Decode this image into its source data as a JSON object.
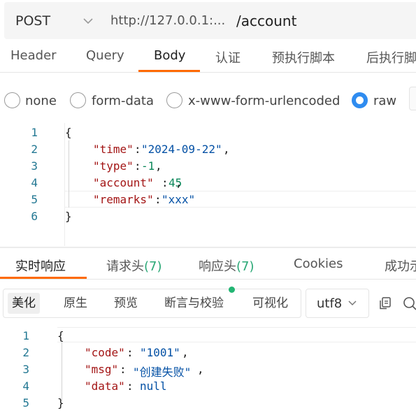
{
  "request": {
    "method": "POST",
    "url_base": "http://127.0.0.1:...",
    "url_path": "/account"
  },
  "request_tabs": [
    {
      "label": "Header"
    },
    {
      "label": "Query"
    },
    {
      "label": "Body"
    },
    {
      "label": "认证"
    },
    {
      "label": "预执行脚本"
    },
    {
      "label": "后执行脚"
    }
  ],
  "active_request_tab": "Body",
  "body_types": [
    {
      "label": "none",
      "checked": false
    },
    {
      "label": "form-data",
      "checked": false
    },
    {
      "label": "x-www-form-urlencoded",
      "checked": false
    },
    {
      "label": "raw",
      "checked": true
    }
  ],
  "request_body": {
    "line_numbers": [
      "1",
      "2",
      "3",
      "4",
      "5",
      "6"
    ],
    "open_brace": "{",
    "close_brace": "}",
    "key_time": "\"time\"",
    "val_time": "\"2024-09-22\"",
    "key_type": "\"type\"",
    "val_type": "-1",
    "key_account": "\"account\"",
    "val_account": "45",
    "key_remarks": "\"remarks\"",
    "val_remarks": "\"xxx\"",
    "colon": ":",
    "comma": ","
  },
  "response_tabs": [
    {
      "label": "实时响应"
    },
    {
      "label": "请求头",
      "count": "(7)"
    },
    {
      "label": "响应头",
      "count": "(7)"
    },
    {
      "label": "Cookies"
    },
    {
      "label": "成功示"
    }
  ],
  "active_response_tab": "实时响应",
  "view_modes": [
    {
      "label": "美化",
      "active": true
    },
    {
      "label": "原生",
      "active": false
    },
    {
      "label": "预览",
      "active": false
    },
    {
      "label": "断言与校验",
      "active": false
    },
    {
      "label": "可视化",
      "active": false
    }
  ],
  "encoding": "utf8",
  "response_body": {
    "line_numbers": [
      "1",
      "2",
      "3",
      "4",
      "5"
    ],
    "open_brace": "{",
    "close_brace": "}",
    "key_code": "\"code\"",
    "val_code": "\"1001\"",
    "key_msg": "\"msg\"",
    "val_msg": "\"创建失败\"",
    "key_data": "\"data\"",
    "val_data": "null",
    "colon_sp": ": ",
    "comma": ","
  },
  "colors": {
    "accent": "#ff6a00",
    "radio_checked": "#2f8cf0",
    "count_green": "#2aa876",
    "json_key": "#a31515",
    "json_string": "#0451a5",
    "json_number": "#098658"
  },
  "icons": [
    "chevron-down-icon",
    "copy-icon",
    "search-icon"
  ]
}
